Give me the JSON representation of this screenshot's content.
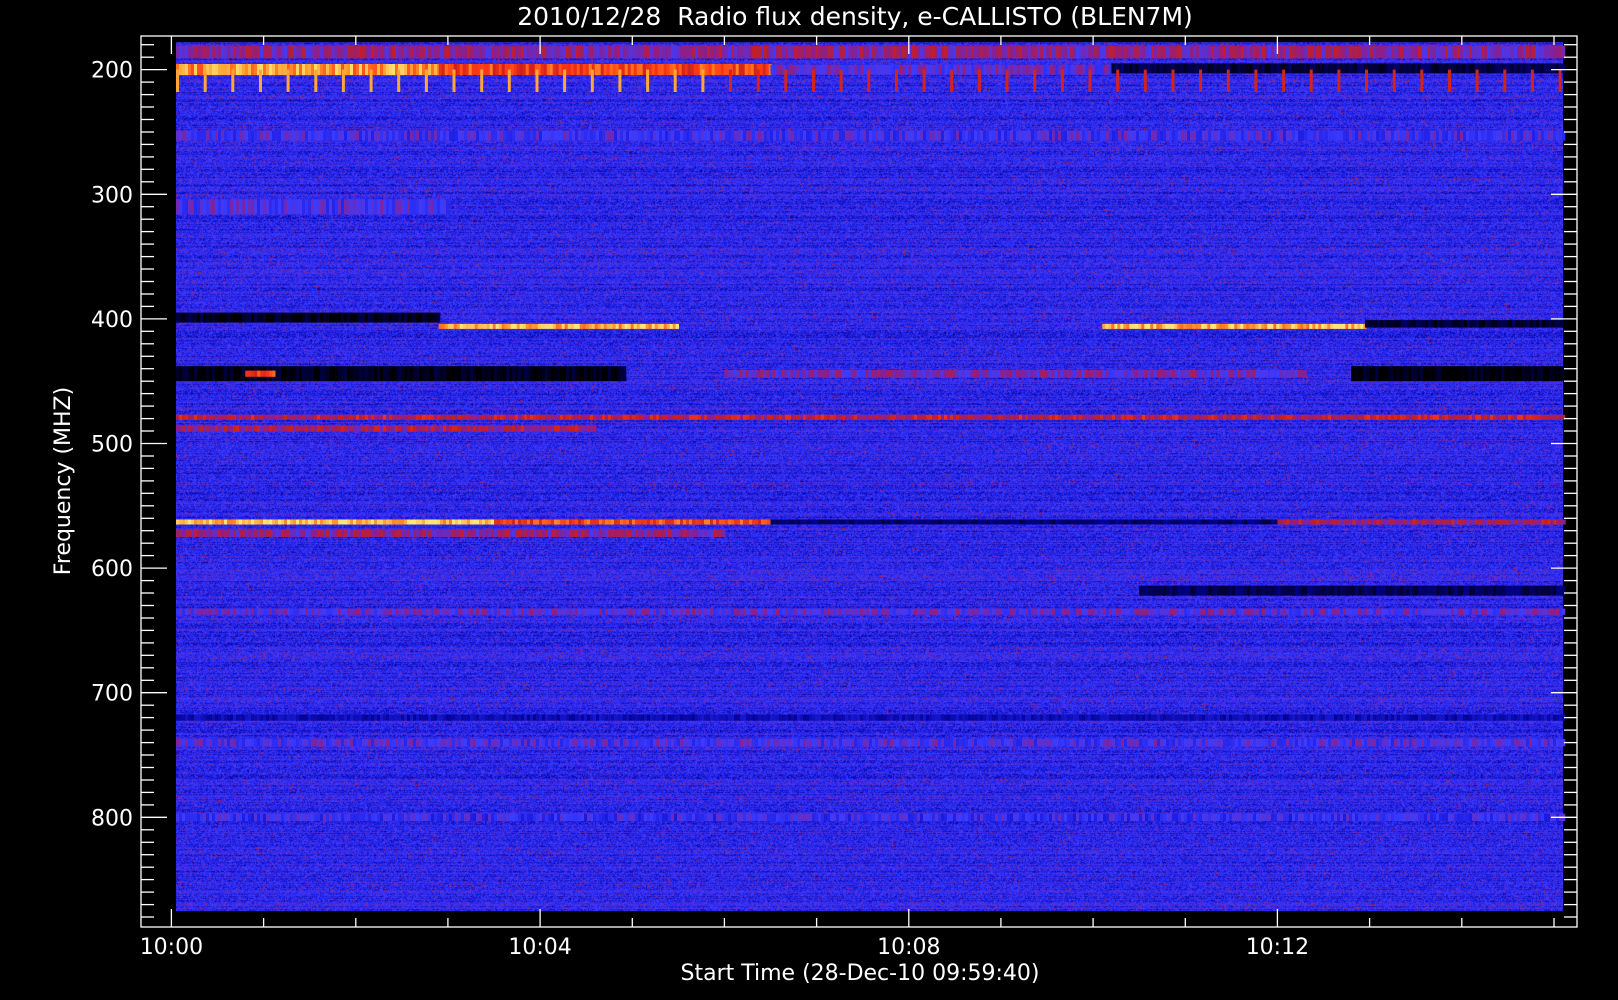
{
  "chart_data": {
    "type": "heatmap",
    "title": "2010/12/28  Radio flux density, e-CALLISTO (BLEN7M)",
    "xlabel": "Start Time (28-Dec-10 09:59:40)",
    "ylabel": "Frequency (MHZ)",
    "x_range_minutes": [
      -0.33,
      15.25
    ],
    "y_range_mhz": [
      173,
      888
    ],
    "data_x_range_minutes": [
      0.05,
      15.1
    ],
    "data_y_range_mhz": [
      178,
      875
    ],
    "x_ticks": [
      {
        "value": 0,
        "label": "10:00"
      },
      {
        "value": 4,
        "label": "10:04"
      },
      {
        "value": 8,
        "label": "10:08"
      },
      {
        "value": 12,
        "label": "10:12"
      }
    ],
    "x_minor_step_minutes": 1,
    "y_ticks": [
      {
        "value": 200,
        "label": "200"
      },
      {
        "value": 300,
        "label": "300"
      },
      {
        "value": 400,
        "label": "400"
      },
      {
        "value": 500,
        "label": "500"
      },
      {
        "value": 600,
        "label": "600"
      },
      {
        "value": 700,
        "label": "700"
      },
      {
        "value": 800,
        "label": "800"
      }
    ],
    "y_minor_step_mhz": 10,
    "colormap": [
      "#000000",
      "#00008c",
      "#1e1ee6",
      "#3c3cff",
      "#8c1e8c",
      "#c81e1e",
      "#ff3c14",
      "#ff9628",
      "#ffe678"
    ],
    "background_level": 0.3,
    "features": [
      {
        "kind": "band",
        "f": 200,
        "h": 9,
        "t0": 0.05,
        "t1": 2.9,
        "level": 0.88
      },
      {
        "kind": "band",
        "f": 200,
        "h": 9,
        "t0": 2.9,
        "t1": 6.5,
        "level": 0.74
      },
      {
        "kind": "band",
        "f": 200,
        "h": 8,
        "t0": 6.5,
        "t1": 10.2,
        "level": 0.42
      },
      {
        "kind": "band",
        "f": 199,
        "h": 8,
        "t0": 10.2,
        "t1": 15.1,
        "level": 0.06
      },
      {
        "kind": "band",
        "f": 186,
        "h": 10,
        "t0": 0.05,
        "t1": 15.1,
        "level": 0.5
      },
      {
        "kind": "band",
        "f": 253,
        "h": 8,
        "t0": 0.05,
        "t1": 15.1,
        "level": 0.36
      },
      {
        "kind": "band",
        "f": 310,
        "h": 12,
        "t0": 0.05,
        "t1": 3.0,
        "level": 0.38
      },
      {
        "kind": "band",
        "f": 399,
        "h": 8,
        "t0": 0.05,
        "t1": 2.9,
        "level": 0.03
      },
      {
        "kind": "band",
        "f": 406,
        "h": 4,
        "t0": 2.9,
        "t1": 5.5,
        "level": 0.92
      },
      {
        "kind": "band",
        "f": 406,
        "h": 4,
        "t0": 10.1,
        "t1": 12.95,
        "level": 0.93
      },
      {
        "kind": "band",
        "f": 404,
        "h": 6,
        "t0": 12.95,
        "t1": 15.1,
        "level": 0.05
      },
      {
        "kind": "band",
        "f": 444,
        "h": 12,
        "t0": 0.05,
        "t1": 4.9,
        "level": 0.02
      },
      {
        "kind": "band",
        "f": 444,
        "h": 12,
        "t0": 12.8,
        "t1": 15.1,
        "level": 0.02
      },
      {
        "kind": "band",
        "f": 444,
        "h": 5,
        "t0": 0.8,
        "t1": 1.1,
        "level": 0.7
      },
      {
        "kind": "band",
        "f": 444,
        "h": 6,
        "t0": 6.0,
        "t1": 12.3,
        "level": 0.45
      },
      {
        "kind": "band",
        "f": 479,
        "h": 4,
        "t0": 0.05,
        "t1": 15.1,
        "level": 0.6
      },
      {
        "kind": "band",
        "f": 488,
        "h": 5,
        "t0": 0.05,
        "t1": 4.6,
        "level": 0.55
      },
      {
        "kind": "band",
        "f": 563,
        "h": 4,
        "t0": 0.05,
        "t1": 3.5,
        "level": 0.95
      },
      {
        "kind": "band",
        "f": 563,
        "h": 4,
        "t0": 3.5,
        "t1": 6.5,
        "level": 0.75
      },
      {
        "kind": "band",
        "f": 563,
        "h": 4,
        "t0": 6.5,
        "t1": 12.0,
        "level": 0.1
      },
      {
        "kind": "band",
        "f": 563,
        "h": 4,
        "t0": 12.0,
        "t1": 15.1,
        "level": 0.55
      },
      {
        "kind": "band",
        "f": 572,
        "h": 6,
        "t0": 0.05,
        "t1": 6.0,
        "level": 0.5
      },
      {
        "kind": "band",
        "f": 618,
        "h": 8,
        "t0": 10.5,
        "t1": 15.1,
        "level": 0.08
      },
      {
        "kind": "band",
        "f": 635,
        "h": 5,
        "t0": 0.05,
        "t1": 15.1,
        "level": 0.42
      },
      {
        "kind": "band",
        "f": 720,
        "h": 5,
        "t0": 0.05,
        "t1": 15.1,
        "level": 0.18
      },
      {
        "kind": "band",
        "f": 740,
        "h": 6,
        "t0": 0.05,
        "t1": 15.1,
        "level": 0.38
      },
      {
        "kind": "band",
        "f": 800,
        "h": 6,
        "t0": 0.05,
        "t1": 15.1,
        "level": 0.34
      }
    ],
    "spikes": {
      "f_min": 200,
      "f_max": 218,
      "start_minutes": 0.05,
      "period_minutes": 0.3,
      "level": 0.9
    }
  }
}
